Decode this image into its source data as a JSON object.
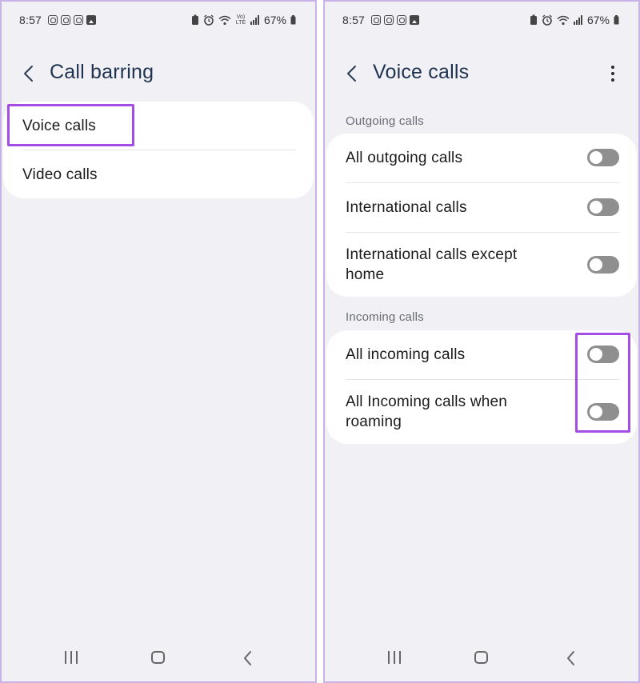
{
  "status_bar": {
    "time": "8:57",
    "battery": "67%",
    "network_label": "Vo) LTE"
  },
  "left_screen": {
    "title": "Call barring",
    "items": [
      {
        "label": "Voice calls"
      },
      {
        "label": "Video calls"
      }
    ]
  },
  "right_screen": {
    "title": "Voice calls",
    "outgoing_header": "Outgoing calls",
    "outgoing_items": [
      {
        "label": "All outgoing calls",
        "on": false
      },
      {
        "label": "International calls",
        "on": false
      },
      {
        "label": "International calls except home",
        "on": false
      }
    ],
    "incoming_header": "Incoming calls",
    "incoming_items": [
      {
        "label": "All incoming calls",
        "on": false
      },
      {
        "label": "All Incoming calls when roaming",
        "on": false
      }
    ]
  },
  "colors": {
    "highlight": "#a44ce6",
    "title": "#1f3350",
    "toggle_off": "#8f8f8f",
    "background": "#f0f0f5"
  }
}
